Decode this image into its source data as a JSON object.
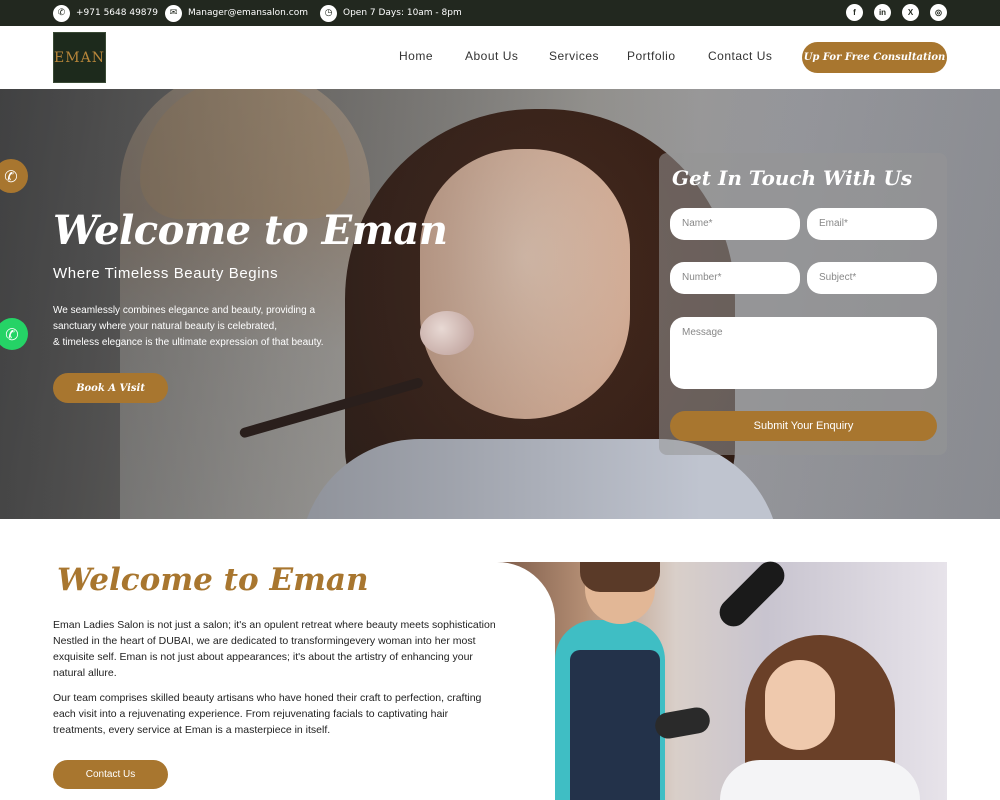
{
  "topbar": {
    "phone": "+971 5648 49879",
    "email": "Manager@emansalon.com",
    "hours": "Open 7 Days: 10am - 8pm",
    "social": [
      {
        "name": "facebook-icon",
        "glyph": "f"
      },
      {
        "name": "linkedin-icon",
        "glyph": "in"
      },
      {
        "name": "x-icon",
        "glyph": "X"
      },
      {
        "name": "instagram-icon",
        "glyph": "◎"
      }
    ],
    "bg_color": "#22281f"
  },
  "header": {
    "logo_text": "EMAN",
    "nav": [
      "Home",
      "About Us",
      "Services",
      "Portfolio",
      "Contact Us"
    ],
    "cta_label": "Up For Free Consultation",
    "accent_color": "#a8762f"
  },
  "hero": {
    "title": "Welcome to Eman",
    "subtitle": "Where Timeless Beauty Begins",
    "description_lines": [
      "We seamlessly combines elegance and beauty, providing a",
      "sanctuary where your natural beauty is celebrated,",
      "& timeless elegance is the ultimate expression of that beauty."
    ],
    "button_label": "Book A Visit"
  },
  "form": {
    "title": "Get In Touch With Us",
    "name_placeholder": "Name*",
    "email_placeholder": "Email*",
    "number_placeholder": "Number*",
    "subject_placeholder": "Subject*",
    "message_placeholder": "Message",
    "submit_label": "Submit Your Enquiry"
  },
  "about": {
    "title": "Welcome to Eman",
    "paragraph1": "Eman Ladies Salon is not just a salon; it's an opulent retreat where beauty meets sophistication. Nestled in the heart of DUBAI, we are dedicated to transformingevery woman into her most exquisite self. Eman is not just about appearances; it's about the artistry of enhancing your natural allure.",
    "paragraph2": "Our team comprises skilled beauty artisans who have honed their craft to perfection, crafting each visit into a rejuvenating experience. From rejuvenating facials to captivating hair treatments, every service at Eman is a masterpiece in itself.",
    "button_label": "Contact Us"
  },
  "floating": {
    "phone_icon": "phone-icon",
    "whatsapp_icon": "whatsapp-icon"
  }
}
